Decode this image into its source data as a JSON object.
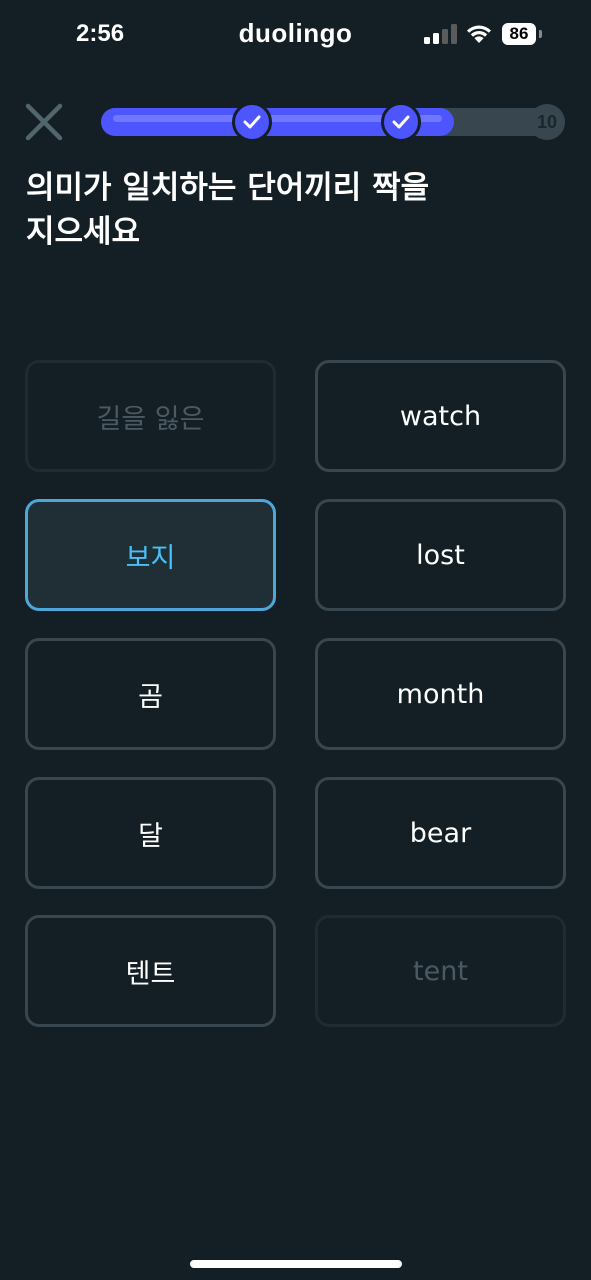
{
  "status_bar": {
    "time": "2:56",
    "app_name": "duolingo",
    "battery": "86"
  },
  "header": {
    "close_icon": "close-icon",
    "progress": {
      "fraction": 0.76,
      "checkpoints": [
        0.32,
        0.64
      ],
      "goal_label": "10",
      "fill_color": "#4d55ff"
    }
  },
  "prompt": {
    "line1": "의미가 일치하는 단어끼리 짝을",
    "line2": "지으세요"
  },
  "tiles": {
    "left": [
      {
        "label": "길을 잃은",
        "state": "matched"
      },
      {
        "label": "보지",
        "state": "selected"
      },
      {
        "label": "곰",
        "state": "default"
      },
      {
        "label": "달",
        "state": "default"
      },
      {
        "label": "텐트",
        "state": "default"
      }
    ],
    "right": [
      {
        "label": "watch",
        "state": "default"
      },
      {
        "label": "lost",
        "state": "default"
      },
      {
        "label": "month",
        "state": "default"
      },
      {
        "label": "bear",
        "state": "default"
      },
      {
        "label": "tent",
        "state": "matched"
      }
    ]
  },
  "colors": {
    "background": "#131f24",
    "tile_border": "#37464f",
    "selected_border": "#4fa6d9",
    "selected_text": "#49c0f8",
    "matched_text": "#4b5a62"
  }
}
